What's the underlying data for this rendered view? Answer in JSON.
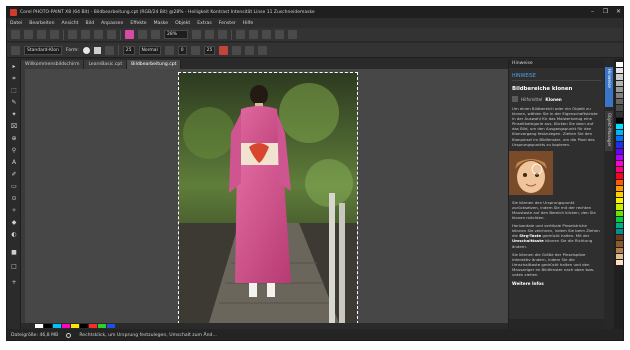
{
  "window": {
    "title": "Corel PHOTO-PAINT X8 (64 Bit) - Bildbearbeitung.cpt (RGB/24 Bit) @28% - Heiligkeit Kontrast Intensität Linse 11 Zuschneidemaske",
    "buttons": [
      "minimize-icon",
      "restore-icon",
      "close-icon"
    ]
  },
  "menu": [
    "Datei",
    "Bearbeiten",
    "Ansicht",
    "Bild",
    "Anpassen",
    "Effekte",
    "Maske",
    "Objekt",
    "Extras",
    "Fenster",
    "Hilfe"
  ],
  "toolbar": {
    "zoom": "28%"
  },
  "propertybar": {
    "brush_type": "Standard-Klon",
    "form_label": "Form:",
    "size": "25",
    "merge_mode": "Normal",
    "transparency": "0",
    "soften": "25"
  },
  "tabs": [
    "Willkommensbildschirm",
    "LearnBasic.cpt",
    "Bildbearbeitung.cpt"
  ],
  "active_tab": 2,
  "status": {
    "file_size": "Dateigröße: 46,8 MB",
    "hint": "Rechtsklick, um Ursprung festzulegen, Umschalt zum Änd..."
  },
  "docker": {
    "header": "Hinweise",
    "section": "HINWEISE",
    "title": "Bildbereiche klonen",
    "tool_prefix": "Hilfsmittel",
    "tool_name": "Klonen",
    "intro": "Um einen Bildbereich oder ein Objekt zu klonen, wählen Sie in der Eigenschaftsleiste in der Auswahl für das Malwerkzeug eine Pinseltkategorie aus. Klicken Sie dann auf das Bild, um den Ausgangspunkt für den Klonvorgang festzulegen. Ziehen Sie den Klonpinsel im Bildfenster, um die Pixel des Ursprungspunkts zu kopieren.",
    "bullet1": "Sie können den Ursprungspunkt zurücksetzen, indem Sie mit der rechten Maustaste auf den Bereich klicken, den Sie klonen möchten.",
    "bullet2_a": "Horizontale und vertikale Pinselstriche können Sie zeichnen, indem Sie beim Ziehen die ",
    "bullet2_b": "Strg-Taste",
    "bullet2_c": " gedrückt halten. Mit der ",
    "bullet2_d": "Umschalttaste",
    "bullet2_e": " können Sie die Richtung ändern.",
    "bullet3": "Sie können die Größe der Pinselspitze interaktiv ändern, indem Sie die Umschalttaste gedrückt halten und den Mauszeiger im Bildfenster nach oben bzw. unten ziehen.",
    "more": "Weitere Infos",
    "vtabs": [
      "Hinweise",
      "Objekt-Manager"
    ]
  },
  "colors": {
    "accent": "#3a76c8",
    "hint_heading": "#4ea3e8"
  }
}
